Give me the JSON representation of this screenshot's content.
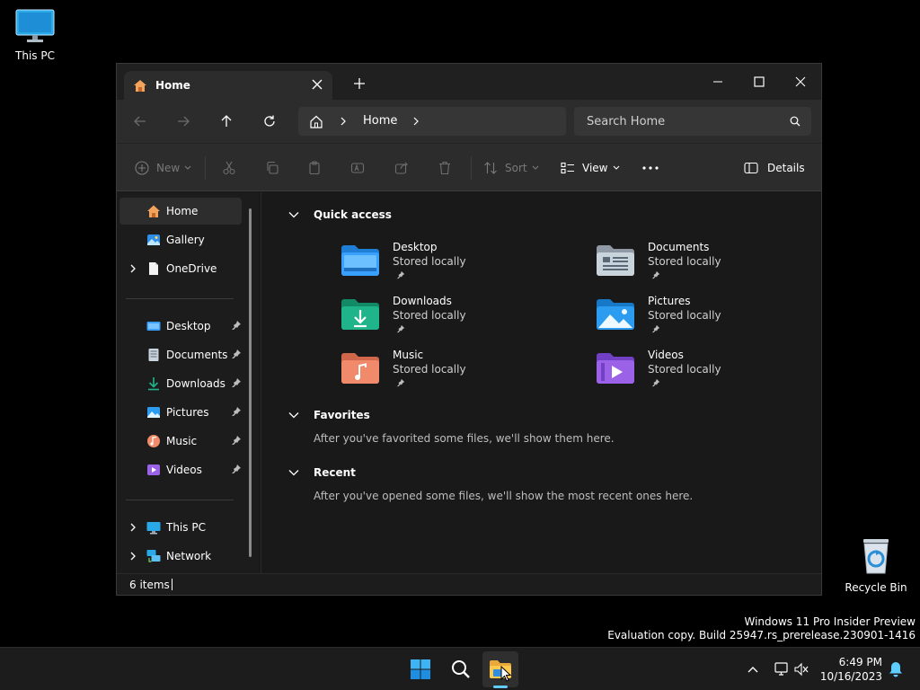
{
  "desktop": {
    "this_pc_label": "This PC",
    "recycle_bin_label": "Recycle Bin"
  },
  "window": {
    "tab_title": "Home",
    "breadcrumb": "Home",
    "search_placeholder": "Search Home",
    "toolbar": {
      "new_label": "New",
      "sort_label": "Sort",
      "view_label": "View",
      "details_label": "Details"
    }
  },
  "sidebar": {
    "items": [
      {
        "label": "Home"
      },
      {
        "label": "Gallery"
      },
      {
        "label": "OneDrive"
      },
      {
        "label": "Desktop"
      },
      {
        "label": "Documents"
      },
      {
        "label": "Downloads"
      },
      {
        "label": "Pictures"
      },
      {
        "label": "Music"
      },
      {
        "label": "Videos"
      },
      {
        "label": "This PC"
      },
      {
        "label": "Network"
      }
    ]
  },
  "content": {
    "quick_access": {
      "title": "Quick access",
      "items": [
        {
          "name": "Desktop",
          "status": "Stored locally",
          "color": "#3aa0ff"
        },
        {
          "name": "Documents",
          "status": "Stored locally",
          "color": "#b8c3d1"
        },
        {
          "name": "Downloads",
          "status": "Stored locally",
          "color": "#20b48a"
        },
        {
          "name": "Pictures",
          "status": "Stored locally",
          "color": "#2b9cf0"
        },
        {
          "name": "Music",
          "status": "Stored locally",
          "color": "#f08a6a"
        },
        {
          "name": "Videos",
          "status": "Stored locally",
          "color": "#9b62e8"
        }
      ]
    },
    "favorites": {
      "title": "Favorites",
      "message": "After you've favorited some files, we'll show them here."
    },
    "recent": {
      "title": "Recent",
      "message": "After you've opened some files, we'll show the most recent ones here."
    }
  },
  "status": {
    "item_count": "6 items"
  },
  "watermark": {
    "line1": "Windows 11 Pro Insider Preview",
    "line2": "Evaluation copy. Build 25947.rs_prerelease.230901-1416"
  },
  "taskbar": {
    "time": "6:49 PM",
    "date": "10/16/2023"
  },
  "colors": {
    "accent": "#60cdff",
    "window_bg": "#191919",
    "toolbar_bg": "#2c2c2c"
  }
}
